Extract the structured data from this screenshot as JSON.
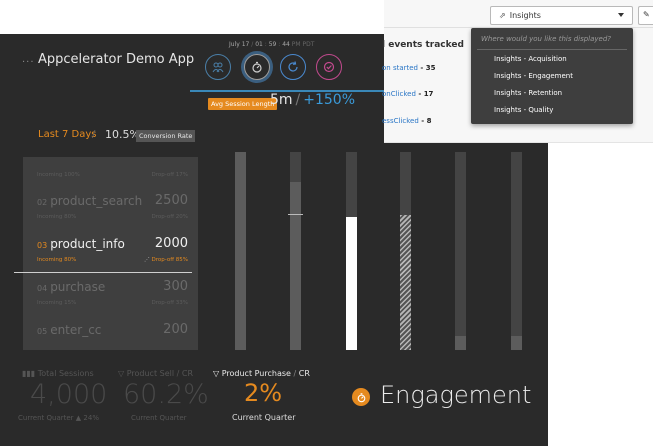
{
  "app": {
    "title": "Appcelerator Demo App",
    "menu_glyph": "···"
  },
  "date_row": {
    "date": "July 17",
    "time": [
      "01",
      "59",
      "44"
    ],
    "suffix": "PM PDT"
  },
  "session": {
    "badge": "Avg Session Length",
    "value": "5m",
    "separator": "/",
    "change": "+150%"
  },
  "range": {
    "label": "Last 7 Days",
    "separator": "/",
    "rate": "10.5%",
    "rate_badge": "Conversion Rate"
  },
  "funnel": {
    "rows": [
      {
        "number": "",
        "name": "",
        "count": "",
        "incoming": "Incoming",
        "incoming_pct": "100%",
        "dropoff": "Drop-off",
        "dropoff_pct": "17%"
      },
      {
        "number": "02",
        "name": "product_search",
        "count": "2500",
        "incoming": "Incoming",
        "incoming_pct": "80%",
        "dropoff": "Drop-off",
        "dropoff_pct": "20%"
      },
      {
        "number": "03",
        "name": "product_info",
        "count": "2000",
        "incoming": "Incoming",
        "incoming_pct": "80%",
        "dropoff": "Drop-off",
        "dropoff_pct": "85%"
      },
      {
        "number": "04",
        "name": "purchase",
        "count": "300",
        "incoming": "Incoming",
        "incoming_pct": "15%",
        "dropoff": "Drop-off",
        "dropoff_pct": "33%"
      },
      {
        "number": "05",
        "name": "enter_cc",
        "count": "200",
        "incoming": "",
        "incoming_pct": "",
        "dropoff": "",
        "dropoff_pct": ""
      }
    ]
  },
  "bars": [
    {
      "fill_fraction": 1.0,
      "style": "solid",
      "marker_fraction": null
    },
    {
      "fill_fraction": 0.85,
      "style": "solid",
      "marker_fraction": 0.68
    },
    {
      "fill_fraction": 0.67,
      "style": "white",
      "marker_fraction": null
    },
    {
      "fill_fraction": 0.68,
      "style": "hatch",
      "marker_fraction": null
    },
    {
      "fill_fraction": 0.07,
      "style": "solid",
      "marker_fraction": null
    },
    {
      "fill_fraction": 0.07,
      "style": "solid",
      "marker_fraction": null
    }
  ],
  "stats": {
    "total_sessions": {
      "label": "Total Sessions",
      "value": "4,000",
      "sub": "Current Quarter",
      "delta": "▲ 24%"
    },
    "product_sell": {
      "label": "Product Sell",
      "separator": "/",
      "suffix": "CR",
      "value": "60.2%",
      "sub": "Current Quarter"
    },
    "product_purchase": {
      "label": "Product Purchase",
      "separator": "/",
      "suffix": "CR",
      "value": "2%",
      "sub": "Current Quarter"
    }
  },
  "engagement": {
    "title": "Engagement"
  },
  "events": {
    "title": "l events tracked",
    "items": [
      {
        "name": "on started",
        "separator": " - ",
        "count": "35"
      },
      {
        "name": "onClicked",
        "separator": " - ",
        "count": "17"
      },
      {
        "name": "essClicked",
        "separator": " - ",
        "count": "8"
      }
    ]
  },
  "dropdown": {
    "selected": "Insights",
    "edge_glyph": "✎",
    "placeholder": "Where would you like this displayed?",
    "options": [
      "Insights - Acquisition",
      "Insights - Engagement",
      "Insights - Retention",
      "Insights - Quality"
    ]
  },
  "colors": {
    "accent_orange": "#e58a1f",
    "accent_blue": "#3a9ad9",
    "dark_bg": "#2a2a2a",
    "panel_bg": "#3f3f3f"
  }
}
